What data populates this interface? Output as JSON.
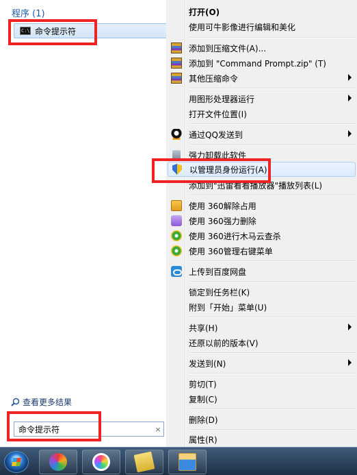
{
  "start_menu": {
    "section_header": "程序 (1)",
    "result_item": {
      "icon": "cmd-window-icon",
      "label": "命令提示符"
    },
    "more_results": "查看更多结果",
    "search": {
      "value": "命令提示符",
      "clear_icon": "×"
    }
  },
  "context_menu": {
    "items": [
      {
        "label": "打开(O)",
        "bold": true
      },
      {
        "label": "使用可牛影像进行编辑和美化"
      },
      {
        "label": "添加到压缩文件(A)...",
        "icon": "winrar-icon"
      },
      {
        "label": "添加到 \"Command Prompt.zip\" (T)",
        "icon": "winrar-icon"
      },
      {
        "label": "其他压缩命令",
        "icon": "winrar-icon",
        "submenu": true
      },
      {
        "label": "用图形处理器运行",
        "submenu": true
      },
      {
        "label": "打开文件位置(I)"
      },
      {
        "label": "通过QQ发送到",
        "icon": "qq-icon",
        "submenu": true
      },
      {
        "label": "强力卸载此软件",
        "icon": "trash-icon"
      },
      {
        "label": "以管理员身份运行(A)",
        "icon": "uac-shield-icon",
        "selected": true
      },
      {
        "label": "添加到\"迅雷看看播放器\"播放列表(L)"
      },
      {
        "label": "使用 360解除占用",
        "icon": "360-unlock-icon"
      },
      {
        "label": "使用 360强力删除",
        "icon": "360-delete-icon"
      },
      {
        "label": "使用 360进行木马云查杀",
        "icon": "360-scan-icon"
      },
      {
        "label": "使用 360管理右键菜单",
        "icon": "360-menu-icon"
      },
      {
        "label": "上传到百度网盘",
        "icon": "baidu-cloud-icon"
      },
      {
        "label": "锁定到任务栏(K)"
      },
      {
        "label": "附到「开始」菜单(U)"
      },
      {
        "label": "共享(H)",
        "submenu": true
      },
      {
        "label": "还原以前的版本(V)"
      },
      {
        "label": "发送到(N)",
        "submenu": true
      },
      {
        "label": "剪切(T)"
      },
      {
        "label": "复制(C)"
      },
      {
        "label": "删除(D)"
      },
      {
        "label": "属性(R)"
      }
    ]
  },
  "taskbar": {
    "start_button": "windows-orb-icon",
    "pinned": [
      "app-icon-1",
      "app-icon-2",
      "app-icon-3",
      "file-explorer-icon"
    ]
  },
  "colors": {
    "highlight_red": "#ee2424",
    "menu_bg": "#f0f0f0",
    "header_blue": "#1e5aa8"
  }
}
